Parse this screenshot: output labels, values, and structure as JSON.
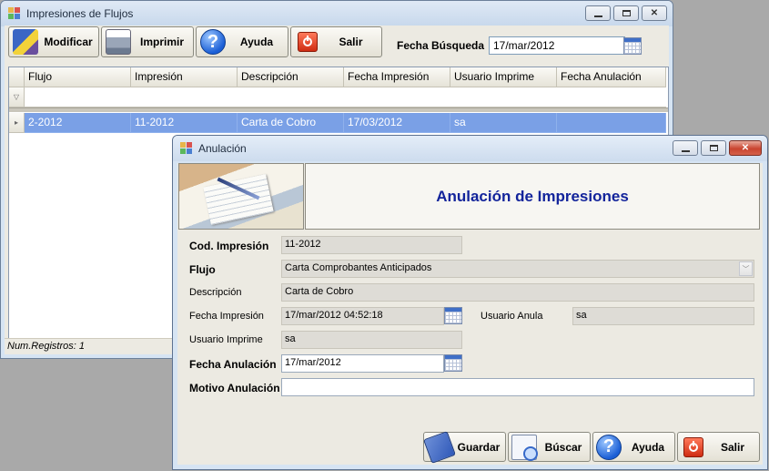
{
  "main": {
    "title": "Impresiones de Flujos",
    "toolbar": {
      "modificar": "Modificar",
      "imprimir": "Imprimir",
      "ayuda": "Ayuda",
      "salir": "Salir"
    },
    "search": {
      "label": "Fecha Búsqueda",
      "value": "17/mar/2012"
    },
    "grid": {
      "columns": [
        "Flujo",
        "Impresión",
        "Descripción",
        "Fecha Impresión",
        "Usuario Imprime",
        "Fecha Anulación"
      ],
      "rows": [
        [
          "2-2012",
          "11-2012",
          "Carta de Cobro",
          "17/03/2012",
          "sa",
          ""
        ]
      ]
    },
    "status": "Num.Registros: 1"
  },
  "dialog": {
    "title": "Anulación",
    "banner": "Anulación de Impresiones",
    "fields": {
      "cod_label": "Cod. Impresión",
      "cod_value": "11-2012",
      "flujo_label": "Flujo",
      "flujo_value": "Carta Comprobantes Anticipados",
      "desc_label": "Descripción",
      "desc_value": "Carta de Cobro",
      "fecha_imp_label": "Fecha Impresión",
      "fecha_imp_value": "17/mar/2012 04:52:18",
      "usuario_anula_label": "Usuario Anula",
      "usuario_anula_value": "sa",
      "usuario_imprime_label": "Usuario Imprime",
      "usuario_imprime_value": "sa",
      "fecha_anul_label": "Fecha Anulación",
      "fecha_anul_value": "17/mar/2012",
      "motivo_label": "Motivo Anulación",
      "motivo_value": ""
    },
    "buttons": {
      "guardar": "Guardar",
      "buscar": "Búscar",
      "ayuda": "Ayuda",
      "salir": "Salir"
    }
  },
  "icons": {
    "help_glyph": "?"
  }
}
